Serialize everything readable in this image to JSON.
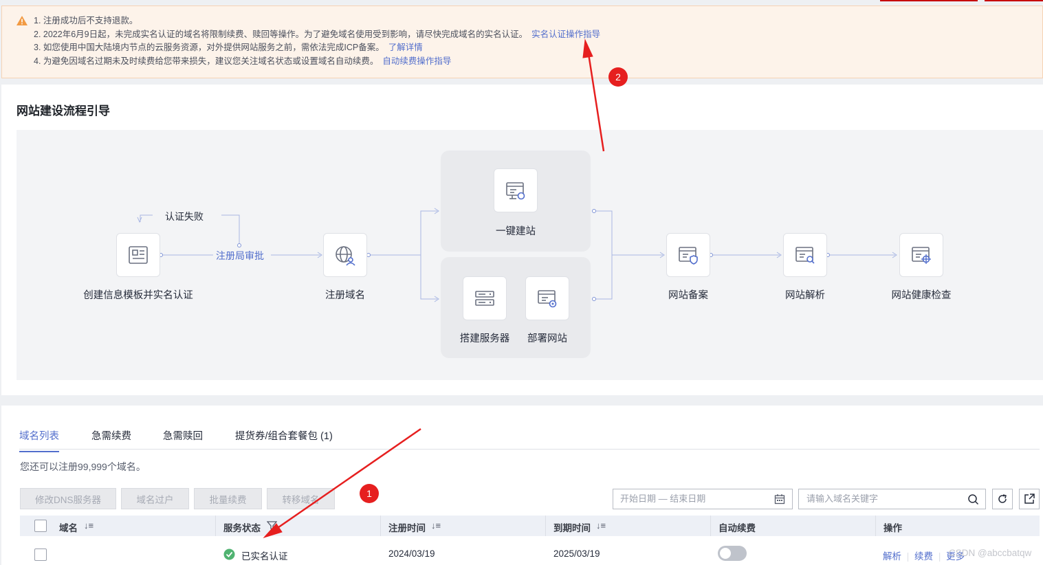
{
  "notice": {
    "items": [
      {
        "text": "1. 注册成功后不支持退款。",
        "link": ""
      },
      {
        "text": "2. 2022年6月9日起，未完成实名认证的域名将限制续费、赎回等操作。为了避免域名使用受到影响，请尽快完成域名的实名认证。",
        "link": "实名认证操作指导"
      },
      {
        "text": "3. 如您使用中国大陆境内节点的云服务资源，对外提供网站服务之前，需依法完成ICP备案。",
        "link": "了解详情"
      },
      {
        "text": "4. 为避免因域名过期未及时续费给您带来损失，建议您关注域名状态或设置域名自动续费。",
        "link": "自动续费操作指导"
      }
    ]
  },
  "guide": {
    "title": "网站建设流程引导",
    "auth_fail": "认证失败",
    "registry_review": "注册局审批",
    "steps": {
      "create_template": "创建信息模板并实名认证",
      "register_domain": "注册域名",
      "one_click_site": "一键建站",
      "build_server": "搭建服务器",
      "deploy_site": "部署网站",
      "site_filing": "网站备案",
      "site_resolve": "网站解析",
      "site_health": "网站健康检查"
    }
  },
  "list": {
    "tabs": [
      "域名列表",
      "急需续费",
      "急需赎回",
      "提货券/组合套餐包 (1)"
    ],
    "hint": "您还可以注册99,999个域名。",
    "buttons": [
      "修改DNS服务器",
      "域名过户",
      "批量续费",
      "转移域名"
    ],
    "date_placeholder": "开始日期 — 结束日期",
    "search_placeholder": "请输入域名关键字",
    "columns": [
      "域名",
      "服务状态",
      "注册时间",
      "到期时间",
      "自动续费",
      "操作"
    ],
    "row": {
      "domain": "",
      "status": "已实名认证",
      "registered": "2024/03/19",
      "expires": "2025/03/19",
      "auto_renew": false,
      "actions": [
        "解析",
        "续费",
        "更多"
      ]
    }
  },
  "annotations": {
    "marker1": "1",
    "marker2": "2"
  },
  "watermark": "CSDN @abccbatqw"
}
